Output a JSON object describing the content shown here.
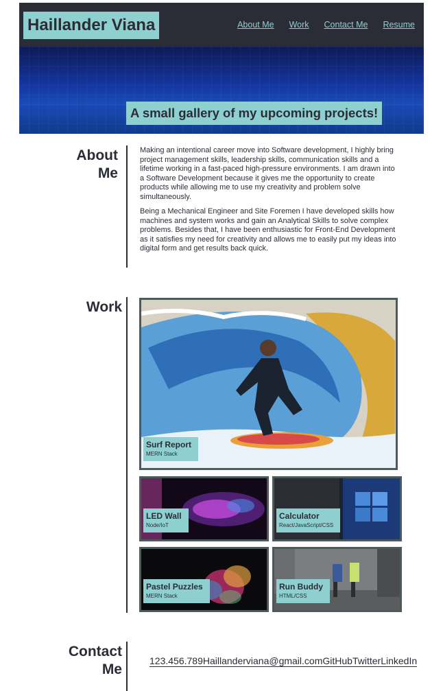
{
  "header": {
    "brand": "Haillander Viana",
    "nav": [
      "About Me",
      "Work",
      "Contact Me",
      "Resume"
    ]
  },
  "hero": {
    "banner": "A small gallery of my upcoming projects!"
  },
  "about": {
    "title_line1": "About",
    "title_line2": "Me",
    "p1": "Making an intentional career move into Software development, I highly bring project management skills, leadership skills, communication skills and a lifetime working in a fast-paced high-pressure environments. I am drawn into a Software Development because it gives me the opportunity to create products while allowing me to use my creativity and problem solve simultaneously.",
    "p2": "Being a Mechanical Engineer and Site Foremen I have developed skills how machines and system works and gain an Analytical Skills to solve complex problems. Besides that, I have been enthusiastic for Front-End Development as it satisfies my need for creativity and allows me to easily put my ideas into digital form and get results back quick."
  },
  "work": {
    "title": "Work",
    "projects": [
      {
        "title": "Surf Report",
        "stack": "MERN Stack"
      },
      {
        "title": "LED Wall",
        "stack": "Node/IoT"
      },
      {
        "title": "Calculator",
        "stack": "React/JavaScript/CSS"
      },
      {
        "title": "Pastel Puzzles",
        "stack": "MERN Stack"
      },
      {
        "title": "Run Buddy",
        "stack": "HTML/CSS"
      }
    ]
  },
  "contact": {
    "title_line1": "Contact",
    "title_line2": "Me",
    "phone": "123.456.789",
    "email": "Haillanderviana@gmail.com",
    "links": [
      "GitHub",
      "Twitter",
      "LinkedIn"
    ]
  },
  "colors": {
    "dark": "#2b2d36",
    "accent": "#8ecfd0",
    "card_border": "#4b5a5a"
  }
}
